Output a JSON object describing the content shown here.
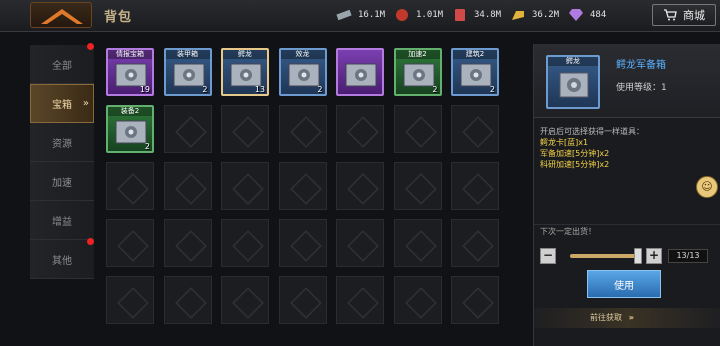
{
  "header": {
    "title": "背包",
    "resources": [
      {
        "name": "steel",
        "value": "16.1M",
        "icon": "steel-icon",
        "color": "#9aa4ad"
      },
      {
        "name": "oil",
        "value": "1.01M",
        "icon": "oil-icon",
        "color": "#c0392b"
      },
      {
        "name": "ammo",
        "value": "34.8M",
        "icon": "ammo-icon",
        "color": "#d14a4a"
      },
      {
        "name": "gold",
        "value": "36.2M",
        "icon": "gold-icon",
        "color": "#e3b23c"
      },
      {
        "name": "diamond",
        "value": "484",
        "icon": "diamond-icon",
        "color": "#b07be0"
      }
    ],
    "shop_label": "商城"
  },
  "sidebar": {
    "tabs": [
      {
        "label": "全部",
        "active": false,
        "dot": true
      },
      {
        "label": "宝箱",
        "active": true,
        "dot": false
      },
      {
        "label": "资源",
        "active": false,
        "dot": false
      },
      {
        "label": "加速",
        "active": false,
        "dot": false
      },
      {
        "label": "增益",
        "active": false,
        "dot": false
      },
      {
        "label": "其他",
        "active": false,
        "dot": true
      }
    ]
  },
  "items": [
    {
      "label": "情报宝箱",
      "count": "19",
      "rarity": "purple"
    },
    {
      "label": "装甲箱",
      "count": "2",
      "rarity": "blue"
    },
    {
      "label": "鳄龙",
      "count": "13",
      "rarity": "blue",
      "selected": true
    },
    {
      "label": "效龙",
      "count": "2",
      "rarity": "blue"
    },
    {
      "label": "",
      "count": "",
      "rarity": "purple"
    },
    {
      "label": "加速2",
      "count": "2",
      "rarity": "green"
    },
    {
      "label": "建筑2",
      "count": "2",
      "rarity": "blue"
    },
    {
      "label": "装备2",
      "count": "2",
      "rarity": "green"
    }
  ],
  "detail": {
    "icon_label": "鳄龙",
    "name": "鳄龙军备箱",
    "level_label": "使用等级：1",
    "desc_intro": "开启后可选择获得一样道具：",
    "rewards": [
      "鳄龙卡[蓝]x1",
      "军备加速[5分钟]x2",
      "科研加速[5分钟]x2"
    ],
    "next_text": "下次一定出货！",
    "quantity": "13/13",
    "minus": "−",
    "plus": "+",
    "use_label": "使用",
    "goto_label": "前往获取"
  }
}
